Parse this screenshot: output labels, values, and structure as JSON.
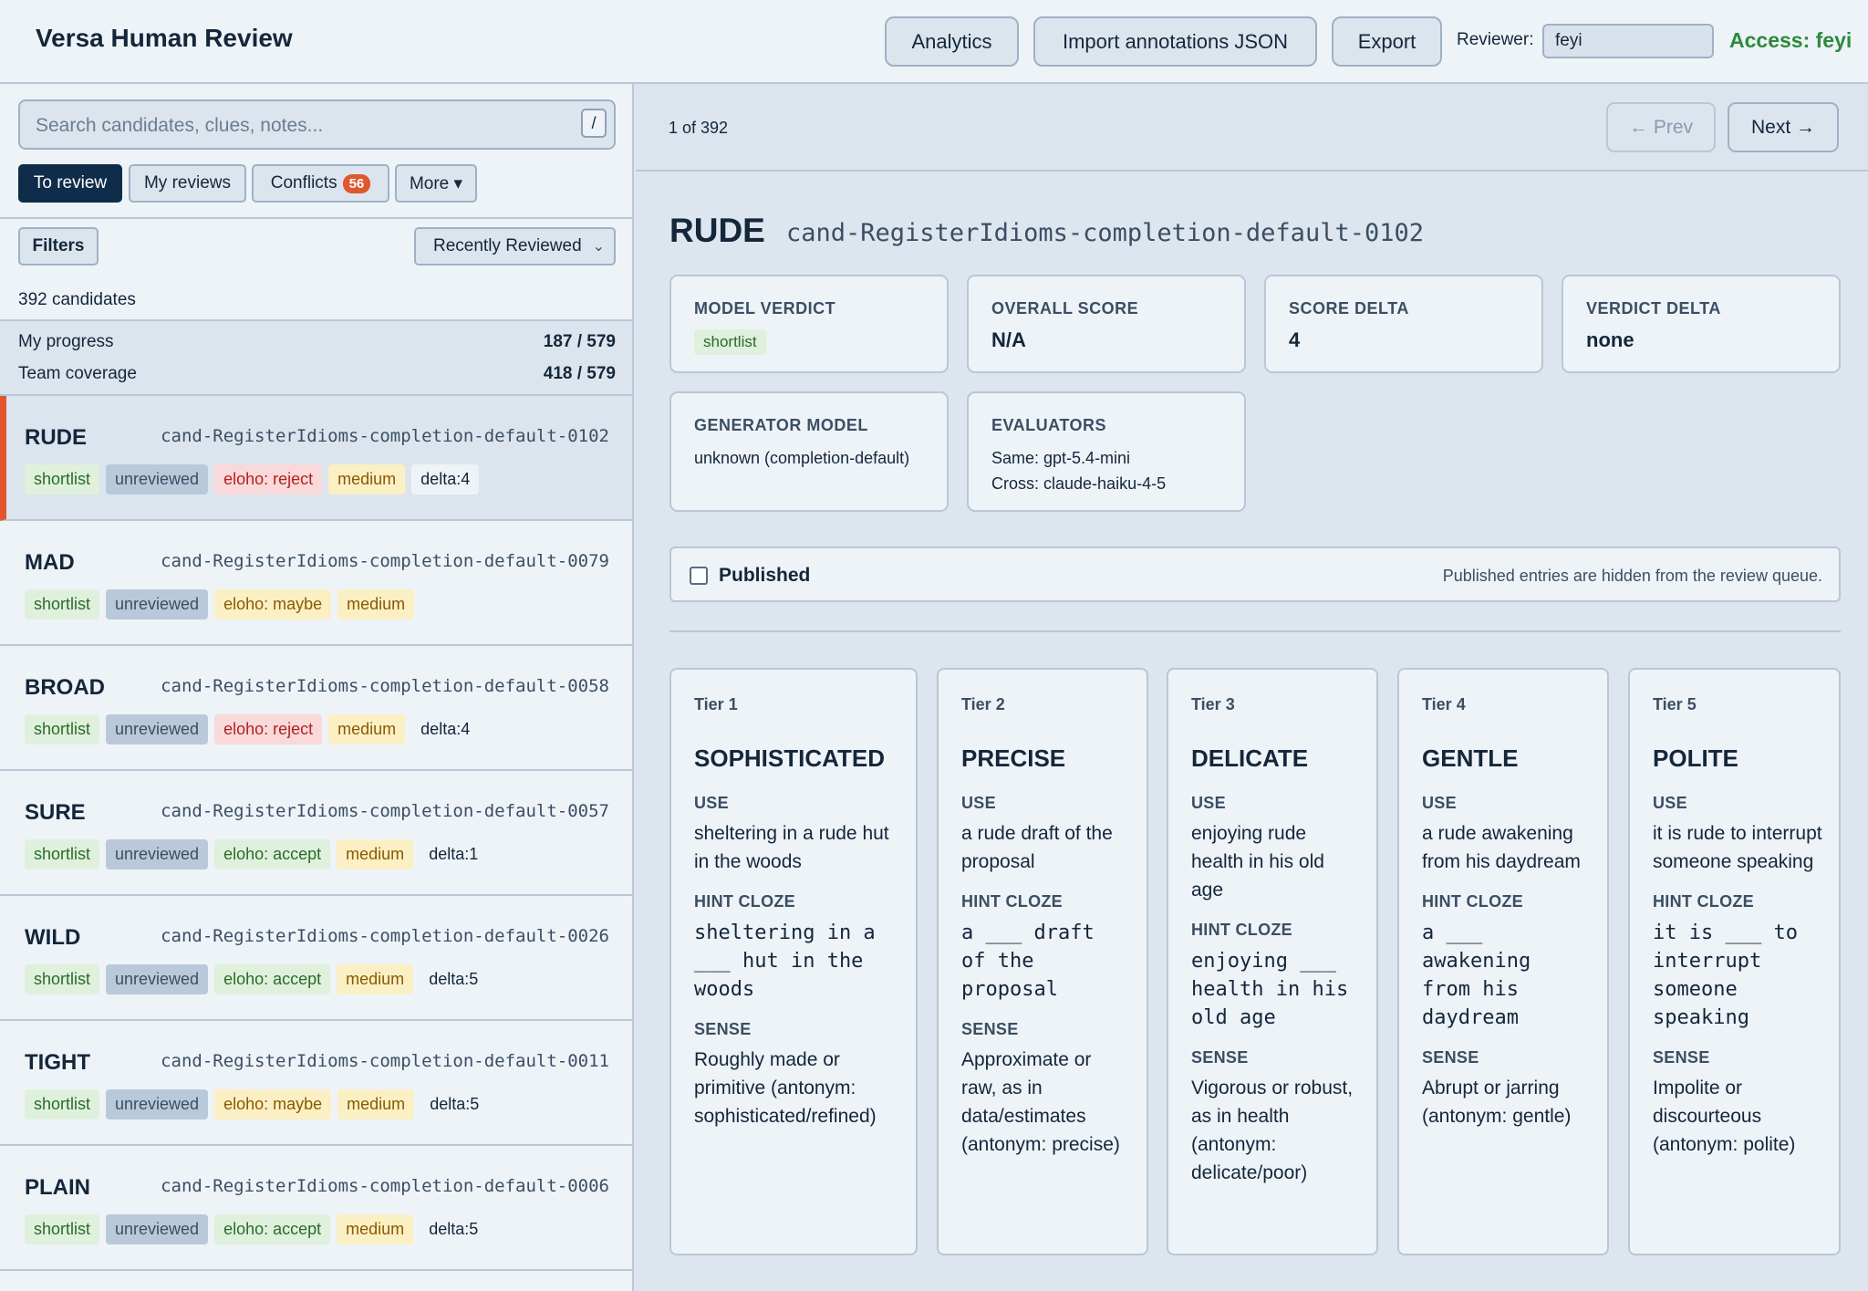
{
  "header": {
    "title": "Versa Human Review",
    "buttons": {
      "analytics": "Analytics",
      "import": "Import annotations JSON",
      "export": "Export"
    },
    "reviewer_label": "Reviewer:",
    "reviewer_value": "feyi",
    "access": "Access: feyi"
  },
  "sidebar": {
    "search_placeholder": "Search candidates, clues, notes...",
    "search_shortcut": "/",
    "tabs": {
      "to_review": "To review",
      "my_reviews": "My reviews",
      "conflicts": "Conflicts",
      "conflicts_count": "56",
      "more": "More ▾"
    },
    "filters_label": "Filters",
    "sort_value": "Recently Reviewed",
    "count_text": "392 candidates",
    "progress": {
      "my_label": "My progress",
      "my_value": "187 / 579",
      "team_label": "Team coverage",
      "team_value": "418 / 579"
    },
    "candidates": [
      {
        "word": "RUDE",
        "id": "cand-RegisterIdioms-completion-default-0102",
        "verdict": "shortlist",
        "status": "unreviewed",
        "eloho": "eloho: reject",
        "level": "medium",
        "delta": "delta:4"
      },
      {
        "word": "MAD",
        "id": "cand-RegisterIdioms-completion-default-0079",
        "verdict": "shortlist",
        "status": "unreviewed",
        "eloho": "eloho: maybe",
        "level": "medium",
        "delta": ""
      },
      {
        "word": "BROAD",
        "id": "cand-RegisterIdioms-completion-default-0058",
        "verdict": "shortlist",
        "status": "unreviewed",
        "eloho": "eloho: reject",
        "level": "medium",
        "delta": "delta:4"
      },
      {
        "word": "SURE",
        "id": "cand-RegisterIdioms-completion-default-0057",
        "verdict": "shortlist",
        "status": "unreviewed",
        "eloho": "eloho: accept",
        "level": "medium",
        "delta": "delta:1"
      },
      {
        "word": "WILD",
        "id": "cand-RegisterIdioms-completion-default-0026",
        "verdict": "shortlist",
        "status": "unreviewed",
        "eloho": "eloho: accept",
        "level": "medium",
        "delta": "delta:5"
      },
      {
        "word": "TIGHT",
        "id": "cand-RegisterIdioms-completion-default-0011",
        "verdict": "shortlist",
        "status": "unreviewed",
        "eloho": "eloho: maybe",
        "level": "medium",
        "delta": "delta:5"
      },
      {
        "word": "PLAIN",
        "id": "cand-RegisterIdioms-completion-default-0006",
        "verdict": "shortlist",
        "status": "unreviewed",
        "eloho": "eloho: accept",
        "level": "medium",
        "delta": "delta:5"
      }
    ]
  },
  "main": {
    "position": "1 of 392",
    "prev": "← Prev",
    "next": "Next →",
    "word": "RUDE",
    "id": "cand-RegisterIdioms-completion-default-0102",
    "metrics": {
      "model_verdict_label": "MODEL VERDICT",
      "model_verdict": "shortlist",
      "overall_label": "OVERALL SCORE",
      "overall": "N/A",
      "score_delta_label": "SCORE DELTA",
      "score_delta": "4",
      "verdict_delta_label": "VERDICT DELTA",
      "verdict_delta": "none",
      "generator_label": "GENERATOR MODEL",
      "generator": "unknown (completion-default)",
      "evaluators_label": "EVALUATORS",
      "evaluators_same": "Same: gpt-5.4-mini",
      "evaluators_cross": "Cross: claude-haiku-4-5"
    },
    "published_label": "Published",
    "published_note": "Published entries are hidden from the review queue.",
    "section_labels": {
      "use": "USE",
      "hint": "HINT CLOZE",
      "sense": "SENSE"
    },
    "tiers": [
      {
        "label": "Tier 1",
        "word": "SOPHISTICATED",
        "use": "sheltering in a rude hut in the woods",
        "hint": "sheltering in a ___ hut in the woods",
        "sense": "Roughly made or primitive (antonym: sophisticated/refined)"
      },
      {
        "label": "Tier 2",
        "word": "PRECISE",
        "use": "a rude draft of the proposal",
        "hint": "a ___ draft of the proposal",
        "sense": "Approximate or raw, as in data/estimates (antonym: precise)"
      },
      {
        "label": "Tier 3",
        "word": "DELICATE",
        "use": "enjoying rude health in his old age",
        "hint": "enjoying ___ health in his old age",
        "sense": "Vigorous or robust, as in health (antonym: delicate/poor)"
      },
      {
        "label": "Tier 4",
        "word": "GENTLE",
        "use": "a rude awakening from his daydream",
        "hint": "a ___ awakening from his daydream",
        "sense": "Abrupt or jarring (antonym: gentle)"
      },
      {
        "label": "Tier 5",
        "word": "POLITE",
        "use": "it is rude to interrupt someone speaking",
        "hint": "it is ___ to interrupt someone speaking",
        "sense": "Impolite or discourteous (antonym: polite)"
      }
    ]
  }
}
